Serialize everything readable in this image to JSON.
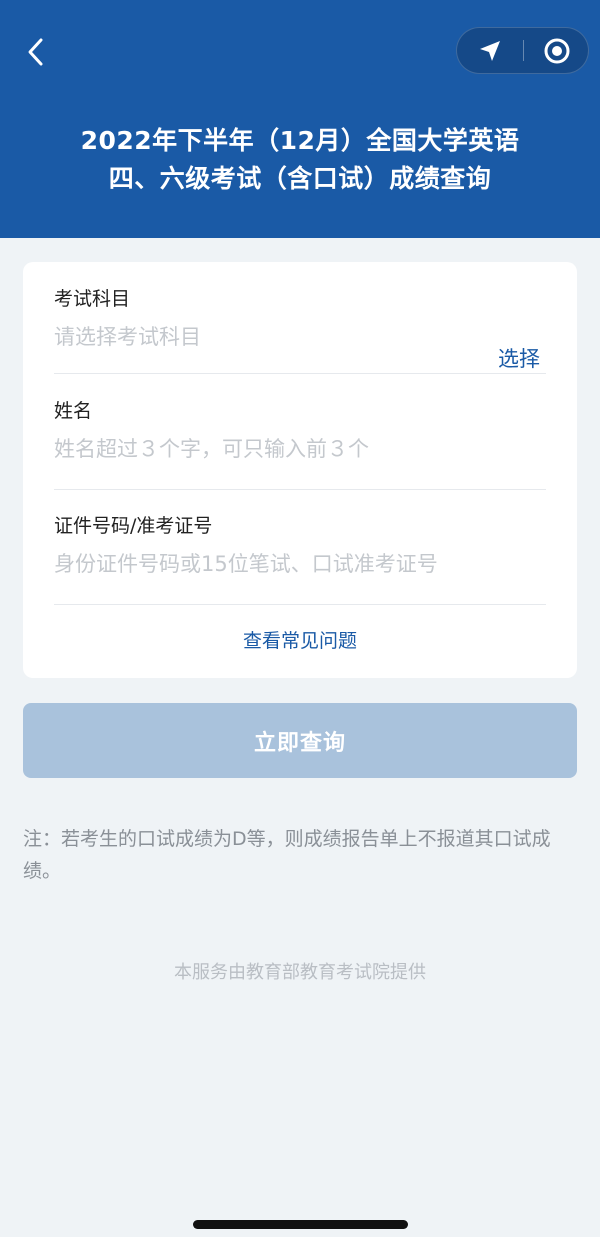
{
  "header": {
    "title_line1": "2022年下半年（12月）全国大学英语",
    "title_line2": "四、六级考试（含口试）成绩查询",
    "background_color": "#1a5aa6",
    "back_icon": "chevron-left-icon",
    "capsule_icons": [
      "location-arrow-icon",
      "record-circle-icon"
    ]
  },
  "form": {
    "subject": {
      "label": "考试科目",
      "placeholder": "请选择考试科目",
      "select_label": "选择"
    },
    "name": {
      "label": "姓名",
      "placeholder": "姓名超过３个字，可只输入前３个"
    },
    "id_number": {
      "label": "证件号码/准考证号",
      "placeholder": "身份证件号码或15位笔试、口试准考证号"
    },
    "faq_link": "查看常见问题"
  },
  "submit_label": "立即查询",
  "note": "注：若考生的口试成绩为D等，则成绩报告单上不报道其口试成绩。",
  "footer": "本服务由教育部教育考试院提供"
}
